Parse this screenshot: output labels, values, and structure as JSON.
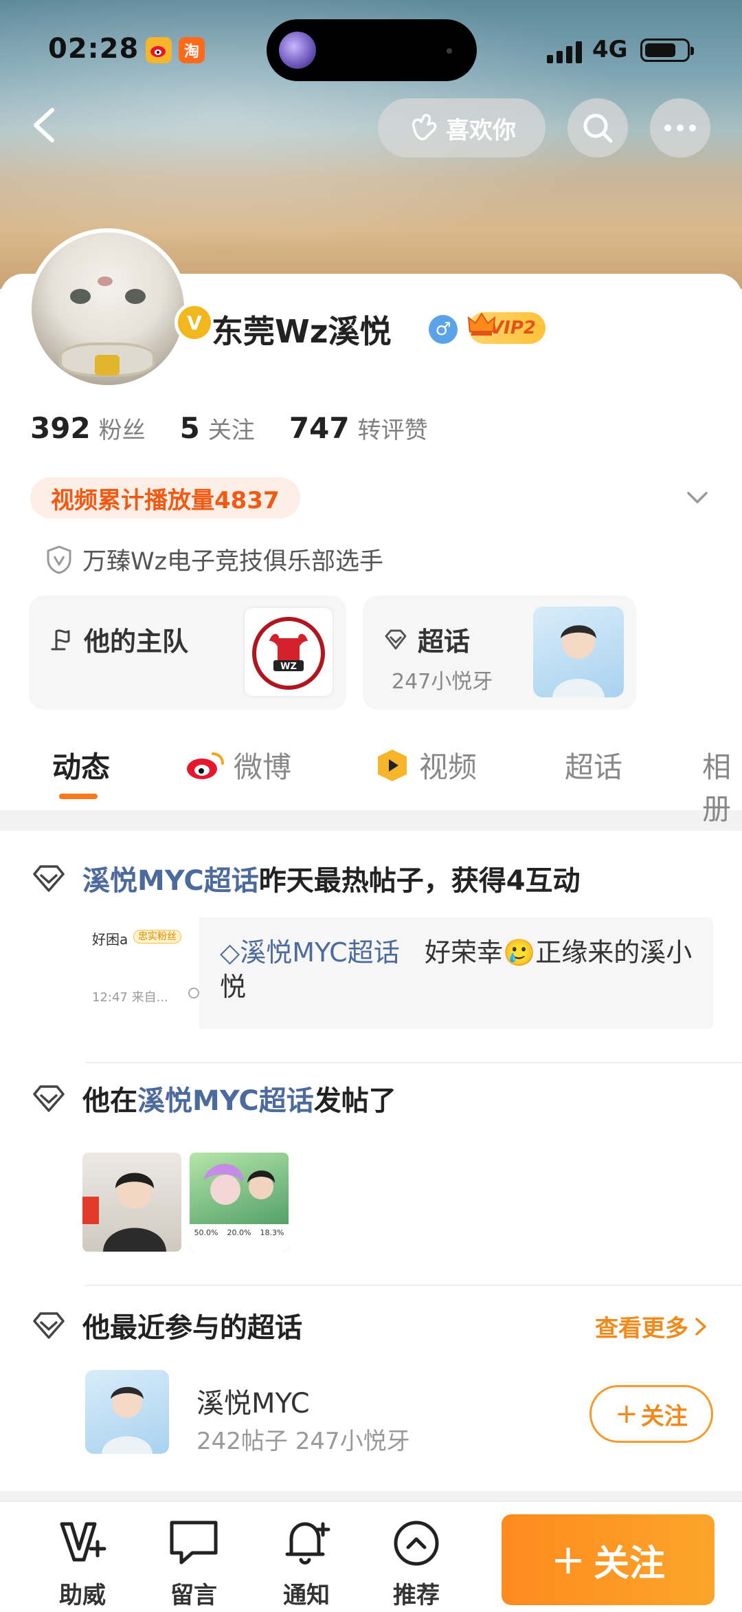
{
  "status_bar": {
    "time": "02:28",
    "app_badges": [
      "微",
      "淘"
    ],
    "network": "4G"
  },
  "header": {
    "like_label": "喜欢你"
  },
  "profile": {
    "username": "东莞Wz溪悦",
    "gender_symbol": "♂",
    "vip_label": "VIP2",
    "verified_badge": "V",
    "stats": [
      {
        "value": "392",
        "label": "粉丝"
      },
      {
        "value": "5",
        "label": "关注"
      },
      {
        "value": "747",
        "label": "转评赞"
      }
    ],
    "video_views_label": "视频累计播放量4837",
    "certification": "万臻Wz电子竞技俱乐部选手",
    "team_card": {
      "title": "他的主队"
    },
    "topic_card": {
      "title": "超话",
      "subtitle": "247小悦牙"
    }
  },
  "tabs": [
    {
      "label": "动态"
    },
    {
      "label": "微博"
    },
    {
      "label": "视频"
    },
    {
      "label": "超话"
    },
    {
      "label": "相册"
    }
  ],
  "feed": {
    "item1": {
      "topic": "溪悦MYC超话",
      "rest": "昨天最热帖子，获得4互动",
      "quote_topic": "溪悦MYC超话",
      "quote_text": "好荣幸🥲正缘来的溪小悦",
      "shot_name": "好困a",
      "shot_badge": "忠实粉丝",
      "shot_time": "12:47 来自..."
    },
    "item2": {
      "prefix": "他在",
      "topic": "溪悦MYC超话",
      "suffix": "发帖了",
      "stats_line": [
        "50.0%",
        "20.0%",
        "18.3%"
      ]
    },
    "item3": {
      "title": "他最近参与的超话",
      "see_more": "查看更多",
      "topic_name": "溪悦MYC",
      "topic_stats": "242帖子 247小悦牙",
      "follow_label": "关注"
    }
  },
  "bottom_bar": {
    "items": [
      {
        "label": "助威",
        "icon": "cheer-icon"
      },
      {
        "label": "留言",
        "icon": "message-icon"
      },
      {
        "label": "通知",
        "icon": "bell-icon"
      },
      {
        "label": "推荐",
        "icon": "recommend-icon"
      }
    ],
    "follow_label": "关注"
  },
  "colors": {
    "accent_orange": "#f57b1d",
    "topic_blue": "#4c6a9c",
    "pill_bg": "#fdeee6"
  }
}
